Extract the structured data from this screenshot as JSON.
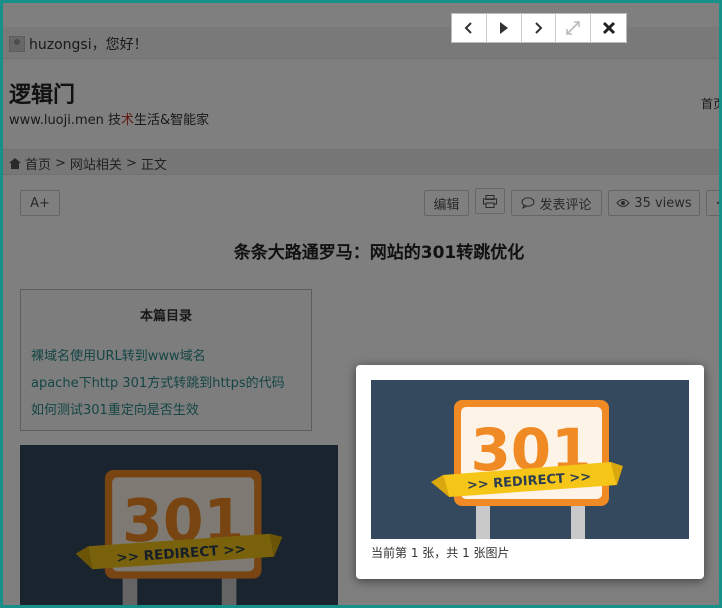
{
  "topbar": {
    "greeting": "huzongsi，您好！"
  },
  "site": {
    "title": "逻辑门",
    "subtitle_pre": "www.luoji.men 技",
    "subtitle_red": "术",
    "subtitle_post": "生活&智能家",
    "nav_home": "首页"
  },
  "breadcrumb": {
    "home": "首页",
    "sep": ">",
    "category": "网站相关",
    "current": "正文"
  },
  "toolbar": {
    "font_size": "A+",
    "edit": "编辑",
    "comment": "发表评论",
    "views": "35 views",
    "more": "<"
  },
  "post": {
    "title": "条条大路通罗马：网站的301转跳优化"
  },
  "toc": {
    "title": "本篇目录",
    "items": [
      "裸域名使用URL转到www域名",
      "apache下http 301方式转跳到https的代码",
      "如何测试301重定向是否生效"
    ]
  },
  "image": {
    "code": "301",
    "banner": ">> REDIRECT >>"
  },
  "viewer": {
    "caption": "当前第 1 张，共 1 张图片"
  },
  "colors": {
    "accent": "#2b8a8a",
    "frame": "#17908a",
    "sign_orange": "#f08a24",
    "banner_yellow": "#f5c518",
    "img_bg": "#34495e"
  }
}
